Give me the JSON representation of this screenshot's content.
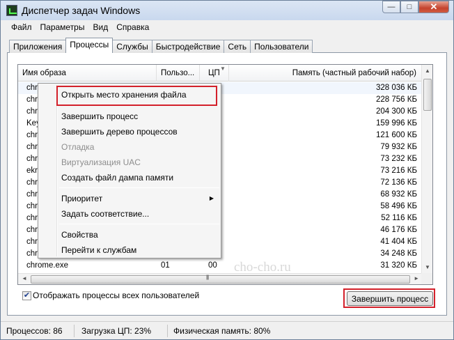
{
  "window": {
    "title": "Диспетчер задач Windows",
    "controls": {
      "minimize": "—",
      "maximize": "□",
      "close": "✕"
    }
  },
  "menu": [
    "Файл",
    "Параметры",
    "Вид",
    "Справка"
  ],
  "tabs": [
    {
      "label": "Приложения",
      "active": false
    },
    {
      "label": "Процессы",
      "active": true
    },
    {
      "label": "Службы",
      "active": false
    },
    {
      "label": "Быстродействие",
      "active": false
    },
    {
      "label": "Сеть",
      "active": false
    },
    {
      "label": "Пользователи",
      "active": false
    }
  ],
  "table": {
    "columns": [
      "Имя образа",
      "Пользо...",
      "ЦП",
      "Память (частный рабочий набор)"
    ],
    "rows": [
      {
        "name": "chrom",
        "user": "",
        "cpu": "",
        "memory": "328 036 КБ"
      },
      {
        "name": "chrom",
        "user": "",
        "cpu": "",
        "memory": "228 756 КБ"
      },
      {
        "name": "chrom",
        "user": "",
        "cpu": "",
        "memory": "204 300 КБ"
      },
      {
        "name": "Key",
        "user": "",
        "cpu": "",
        "memory": "159 996 КБ"
      },
      {
        "name": "chrom",
        "user": "",
        "cpu": "",
        "memory": "121 600 КБ"
      },
      {
        "name": "chrom",
        "user": "",
        "cpu": "",
        "memory": "79 932 КБ"
      },
      {
        "name": "chrom",
        "user": "",
        "cpu": "",
        "memory": "73 232 КБ"
      },
      {
        "name": "ekrn",
        "user": "",
        "cpu": "",
        "memory": "73 216 КБ"
      },
      {
        "name": "chrom",
        "user": "",
        "cpu": "",
        "memory": "72 136 КБ"
      },
      {
        "name": "chrom",
        "user": "",
        "cpu": "",
        "memory": "68 932 КБ"
      },
      {
        "name": "chrom",
        "user": "",
        "cpu": "",
        "memory": "58 496 КБ"
      },
      {
        "name": "chrom",
        "user": "",
        "cpu": "",
        "memory": "52 116 КБ"
      },
      {
        "name": "chrom",
        "user": "",
        "cpu": "",
        "memory": "46 176 КБ"
      },
      {
        "name": "chrom",
        "user": "",
        "cpu": "",
        "memory": "41 404 КБ"
      },
      {
        "name": "chrom",
        "user": "",
        "cpu": "",
        "memory": "34 248 КБ"
      },
      {
        "name": "chrome.exe",
        "user": "01",
        "cpu": "00",
        "memory": "31 320 КБ"
      }
    ]
  },
  "context_menu": {
    "items": [
      {
        "label": "Открыть место хранения файла",
        "disabled": false,
        "highlighted": true
      },
      {
        "label": "Завершить процесс",
        "disabled": false
      },
      {
        "label": "Завершить дерево процессов",
        "disabled": false
      },
      {
        "label": "Отладка",
        "disabled": true
      },
      {
        "label": "Виртуализация UAC",
        "disabled": true
      },
      {
        "label": "Создать файл дампа памяти",
        "disabled": false
      },
      {
        "label": "Приоритет",
        "disabled": false,
        "submenu": true
      },
      {
        "label": "Задать соответствие...",
        "disabled": false
      },
      {
        "label": "Свойства",
        "disabled": false
      },
      {
        "label": "Перейти к службам",
        "disabled": false
      }
    ]
  },
  "show_all_users": {
    "label": "Отображать процессы всех пользователей",
    "checked": true
  },
  "end_process_button": "Завершить процесс",
  "watermark": "cho-cho.ru",
  "status": {
    "processes": "Процессов: 86",
    "cpu": "Загрузка ЦП: 23%",
    "memory": "Физическая память: 80%"
  },
  "colors": {
    "highlight_box": "#d3202a",
    "disabled_text": "#8d8d8d"
  }
}
